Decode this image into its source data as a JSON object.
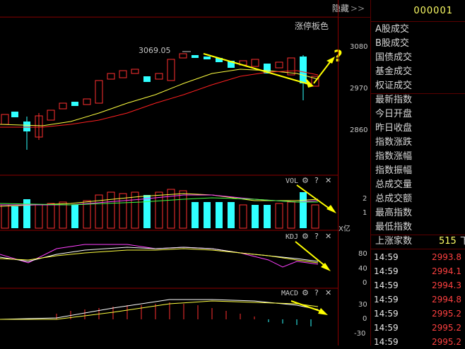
{
  "header": {
    "hide_label": "隐藏",
    "hide_icon": "double-chevron-right-icon",
    "limit_color_label": "涨停板色"
  },
  "main_chart": {
    "high_annotation": "3069.05",
    "price_ticks": [
      "3080",
      "2970",
      "2860"
    ],
    "question_mark": "?"
  },
  "vol_panel": {
    "label": "VOL",
    "ticks": [
      "2",
      "1"
    ],
    "unit": "X亿"
  },
  "kdj_panel": {
    "label": "KDJ",
    "ticks": [
      "80",
      "40",
      "0"
    ]
  },
  "macd_panel": {
    "label": "MACD",
    "ticks": [
      "30",
      "0",
      "-30"
    ]
  },
  "right_panel": {
    "code": "000001",
    "rows": [
      "A股成交",
      "B股成交",
      "国债成交",
      "基金成交",
      "权证成交",
      "最新指数",
      "今日开盘",
      "昨日收盘",
      "指数涨跌",
      "指数涨幅",
      "指数振幅",
      "总成交量",
      "总成交额",
      "最高指数",
      "最低指数"
    ],
    "up_count_label": "上涨家数",
    "up_count_value": "515",
    "up_count_suffix": "下",
    "ticks": [
      {
        "time": "14:59",
        "price": "2993.8"
      },
      {
        "time": "14:59",
        "price": "2994.1"
      },
      {
        "time": "14:59",
        "price": "2994.3"
      },
      {
        "time": "14:59",
        "price": "2994.8"
      },
      {
        "time": "14:59",
        "price": "2995.2"
      },
      {
        "time": "14:59",
        "price": "2995.2"
      },
      {
        "time": "14:59",
        "price": "2995.2"
      }
    ]
  },
  "colors": {
    "up": "#ff3030",
    "down": "#30ffff",
    "ma_yellow": "#ffff40",
    "ma_red": "#ff2020",
    "annotation_arrow": "#ffff00",
    "kdj_purple": "#ff40ff"
  }
}
